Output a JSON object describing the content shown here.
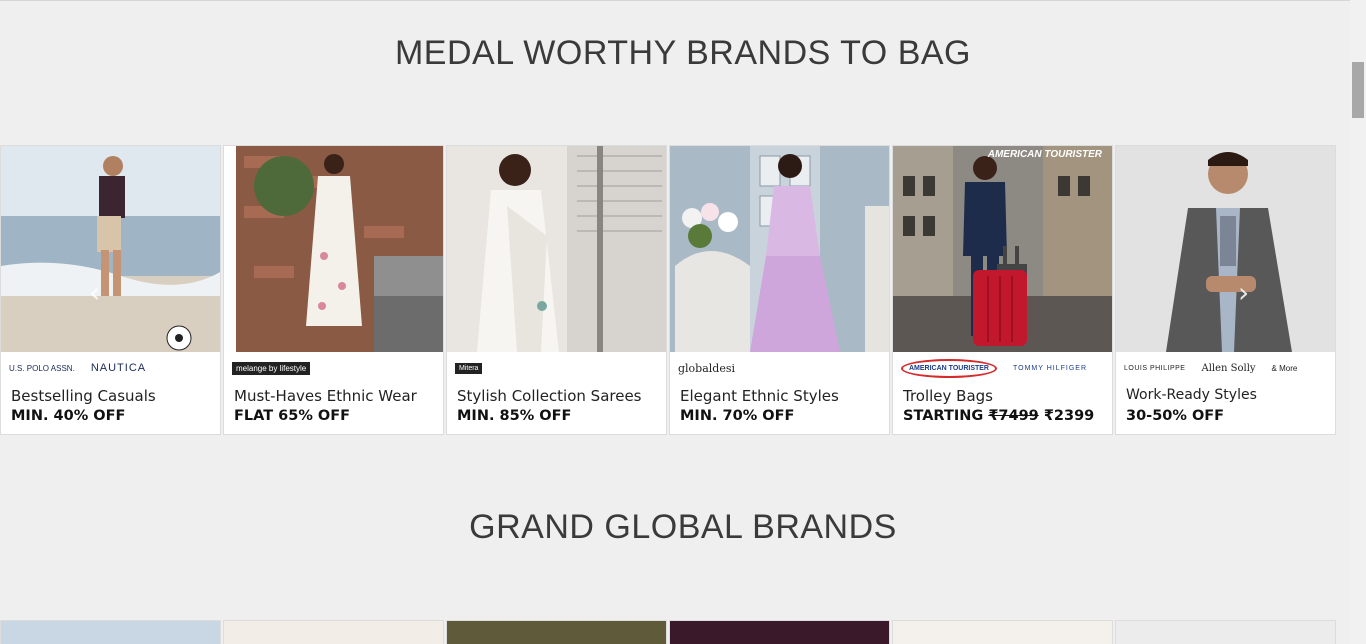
{
  "sections": {
    "first_title": "MEDAL WORTHY BRANDS TO BAG",
    "second_title": "GRAND GLOBAL BRANDS"
  },
  "cards": [
    {
      "brands": [
        "U.S. POLO ASSN.",
        "NAUTICA"
      ],
      "title": "Bestselling Casuals",
      "offer": "MIN. 40% OFF"
    },
    {
      "brands": [
        "melange by lifestyle"
      ],
      "title": "Must-Haves Ethnic Wear",
      "offer": "FLAT 65% OFF"
    },
    {
      "brands": [
        "Mitera"
      ],
      "title": "Stylish Collection Sarees",
      "offer": "MIN. 85% OFF"
    },
    {
      "brands": [
        "globaldesi"
      ],
      "title": "Elegant Ethnic Styles",
      "offer": "MIN. 70% OFF"
    },
    {
      "brands": [
        "AMERICAN TOURISTER",
        "TOMMY HILFIGER"
      ],
      "title": "Trolley Bags",
      "offer_prefix": "STARTING ",
      "offer_old": "₹7499",
      "offer_new": " ₹2399",
      "image_badge": "AMERICAN TOURISTER"
    },
    {
      "brands": [
        "LOUIS PHILIPPE",
        "Allen Solly",
        "& More"
      ],
      "title": "Work-Ready Styles",
      "offer": "30-50% OFF"
    }
  ],
  "icons": {
    "next_arrow": "chevron-right-icon",
    "prev_arrow": "chevron-left-icon"
  },
  "colors": {
    "background": "#efefef",
    "title_text": "#3a3a3a",
    "card_bg": "#ffffff"
  }
}
